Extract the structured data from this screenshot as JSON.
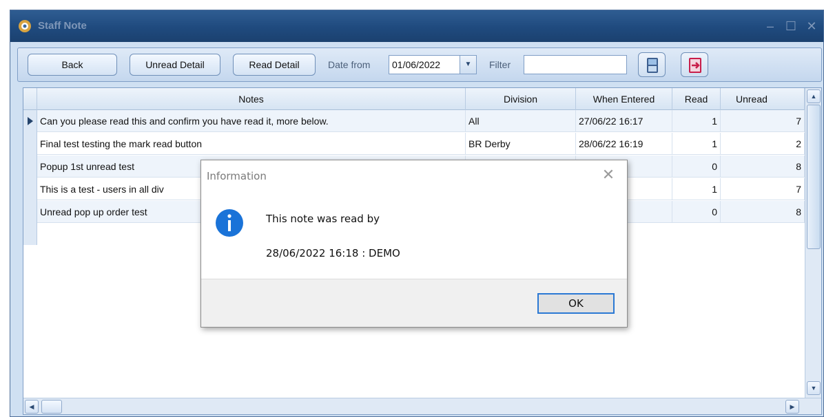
{
  "window": {
    "title": "Staff Note"
  },
  "toolbar": {
    "back_label": "Back",
    "unread_detail_label": "Unread Detail",
    "read_detail_label": "Read Detail",
    "date_from_label": "Date from",
    "date_from_value": "01/06/2022",
    "filter_label": "Filter",
    "filter_value": ""
  },
  "grid": {
    "columns": [
      "Notes",
      "Division",
      "When Entered",
      "Read",
      "Unread"
    ],
    "rows": [
      {
        "notes": "Can you please read this and confirm you have read it, more below.",
        "division": "All",
        "when": "27/06/22 16:17",
        "read": "1",
        "unread": "7"
      },
      {
        "notes": "Final test testing the mark read button",
        "division": "BR Derby",
        "when": "28/06/22 16:19",
        "read": "1",
        "unread": "2"
      },
      {
        "notes": "Popup 1st unread test",
        "division": "",
        "when": "2 17:13",
        "read": "0",
        "unread": "8"
      },
      {
        "notes": "This is a test - users in all div",
        "division": "",
        "when": "2 09:46",
        "read": "1",
        "unread": "7"
      },
      {
        "notes": "Unread pop up order test",
        "division": "",
        "when": "2 14:05",
        "read": "0",
        "unread": "8"
      }
    ]
  },
  "dialog": {
    "title": "Information",
    "message_line1": "This note was read by",
    "message_line2": "28/06/2022 16:18 : DEMO",
    "ok_label": "OK"
  },
  "colors": {
    "title_bar": "#1f4a7e",
    "accent": "#2a78d4",
    "info_icon": "#1a73d8"
  }
}
